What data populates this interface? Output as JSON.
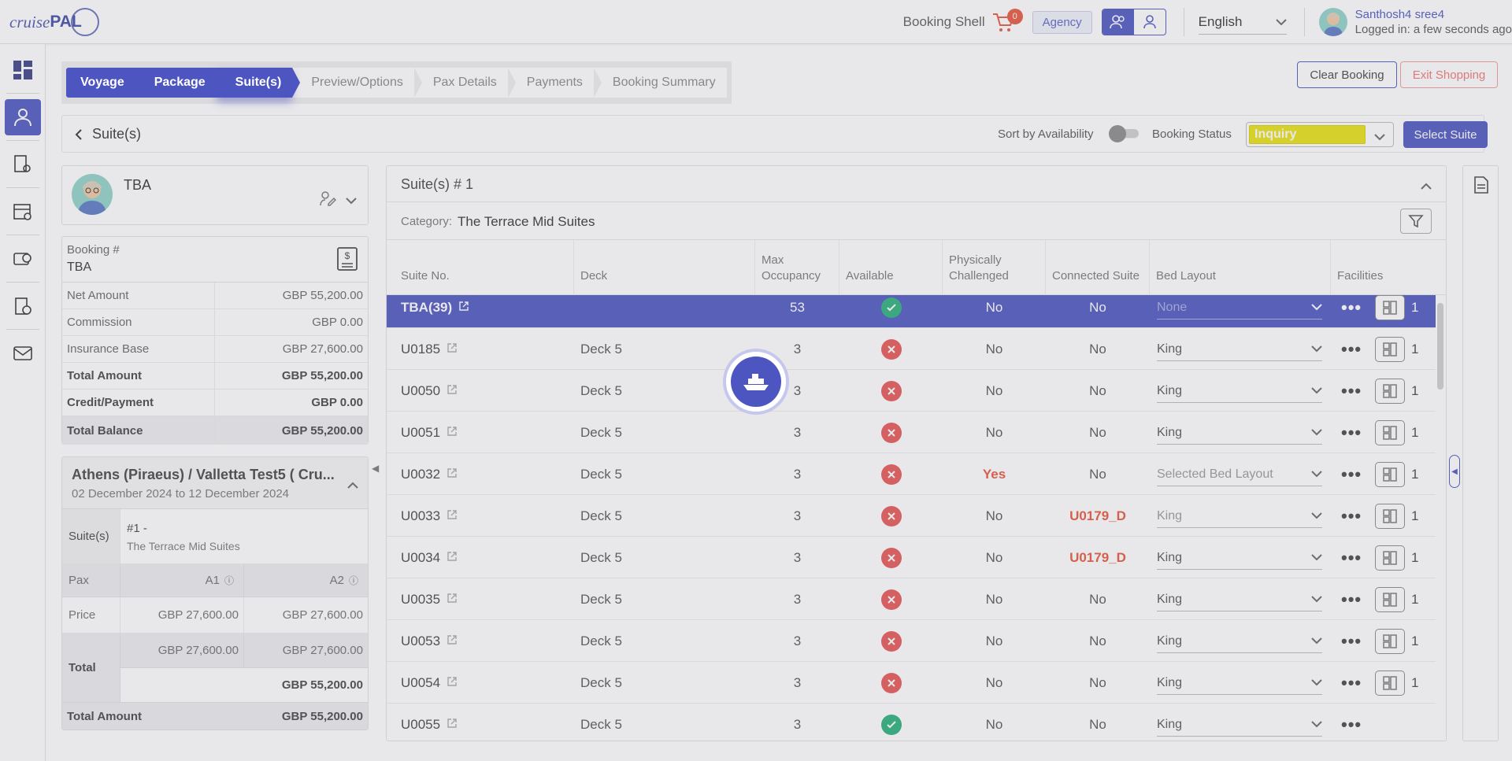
{
  "app": {
    "logo_text_1": "cruise",
    "logo_text_2": "PAL"
  },
  "header": {
    "booking_shell": "Booking Shell",
    "cart_count": "0",
    "agency": "Agency",
    "language": "English",
    "user_name": "Santhosh4 sree4",
    "login_status": "Logged in: a few seconds ago"
  },
  "steps": [
    "Voyage",
    "Package",
    "Suite(s)",
    "Preview/Options",
    "Pax Details",
    "Payments",
    "Booking Summary"
  ],
  "actions": {
    "clear": "Clear Booking",
    "exit": "Exit Shopping"
  },
  "subheader": {
    "back_title": "Suite(s)",
    "sort_label": "Sort by Availability",
    "status_label": "Booking Status",
    "status_value": "Inquiry",
    "select_suite": "Select Suite"
  },
  "pax": {
    "name": "TBA"
  },
  "booking": {
    "label": "Booking #",
    "number": "TBA",
    "rows": [
      {
        "k": "Net Amount",
        "v": "GBP 55,200.00"
      },
      {
        "k": "Commission",
        "v": "GBP 0.00"
      },
      {
        "k": "Insurance Base",
        "v": "GBP 27,600.00"
      },
      {
        "k": "Total Amount",
        "v": "GBP 55,200.00"
      },
      {
        "k": "Credit/Payment",
        "v": "GBP 0.00"
      },
      {
        "k": "Total Balance",
        "v": "GBP 55,200.00"
      }
    ]
  },
  "voyage": {
    "title": "Athens (Piraeus) / Valletta Test5 ( Cru...",
    "dates": "02 December 2024 to 12 December 2024",
    "suites_label": "Suite(s)",
    "suite_no": "#1 -",
    "suite_cat": "The Terrace Mid Suites",
    "pax_label": "Pax",
    "a1": "A1",
    "a2": "A2",
    "price_label": "Price",
    "price_a1": "GBP 27,600.00",
    "price_a2": "GBP 27,600.00",
    "total_label": "Total",
    "total_a1": "GBP 27,600.00",
    "total_a2": "GBP 27,600.00",
    "total_sum": "GBP 55,200.00",
    "total_amount_label": "Total Amount",
    "total_amount": "GBP 55,200.00"
  },
  "suites_panel": {
    "title": "Suite(s) # 1",
    "category_label": "Category:",
    "category": "The Terrace Mid Suites",
    "columns": [
      "Suite No.",
      "Deck",
      "Max Occupancy",
      "Available",
      "Physically Challenged",
      "Connected Suite",
      "Bed Layout",
      "Facilities"
    ],
    "rows": [
      {
        "suite": "TBA(39)",
        "deck": "",
        "max": "53",
        "avail": "yes",
        "pc": "No",
        "conn": "No",
        "bed": "None",
        "fac": "1",
        "hl": true
      },
      {
        "suite": "U0185",
        "deck": "Deck 5",
        "max": "3",
        "avail": "no",
        "pc": "No",
        "conn": "No",
        "bed": "King",
        "fac": "1"
      },
      {
        "suite": "U0050",
        "deck": "Deck 5",
        "max": "3",
        "avail": "no",
        "pc": "No",
        "conn": "No",
        "bed": "King",
        "fac": "1"
      },
      {
        "suite": "U0051",
        "deck": "Deck 5",
        "max": "3",
        "avail": "no",
        "pc": "No",
        "conn": "No",
        "bed": "King",
        "fac": "1"
      },
      {
        "suite": "U0032",
        "deck": "Deck 5",
        "max": "3",
        "avail": "no",
        "pc": "Yes",
        "conn": "No",
        "bed": "Selected Bed Layout",
        "fac": "1"
      },
      {
        "suite": "U0033",
        "deck": "Deck 5",
        "max": "3",
        "avail": "no",
        "pc": "No",
        "conn": "U0179_D",
        "bed": "King",
        "fac": "1"
      },
      {
        "suite": "U0034",
        "deck": "Deck 5",
        "max": "3",
        "avail": "no",
        "pc": "No",
        "conn": "U0179_D",
        "bed": "King",
        "fac": "1"
      },
      {
        "suite": "U0035",
        "deck": "Deck 5",
        "max": "3",
        "avail": "no",
        "pc": "No",
        "conn": "No",
        "bed": "King",
        "fac": "1"
      },
      {
        "suite": "U0053",
        "deck": "Deck 5",
        "max": "3",
        "avail": "no",
        "pc": "No",
        "conn": "No",
        "bed": "King",
        "fac": "1"
      },
      {
        "suite": "U0054",
        "deck": "Deck 5",
        "max": "3",
        "avail": "no",
        "pc": "No",
        "conn": "No",
        "bed": "King",
        "fac": "1"
      },
      {
        "suite": "U0055",
        "deck": "Deck 5",
        "max": "3",
        "avail": "yes",
        "pc": "No",
        "conn": "No",
        "bed": "King",
        "fac": ""
      }
    ]
  },
  "colors": {
    "primary": "#4c55c0",
    "status_yellow": "#e8e112",
    "red": "#e85555",
    "green": "#27b07a",
    "accent_red": "#e8553b"
  }
}
